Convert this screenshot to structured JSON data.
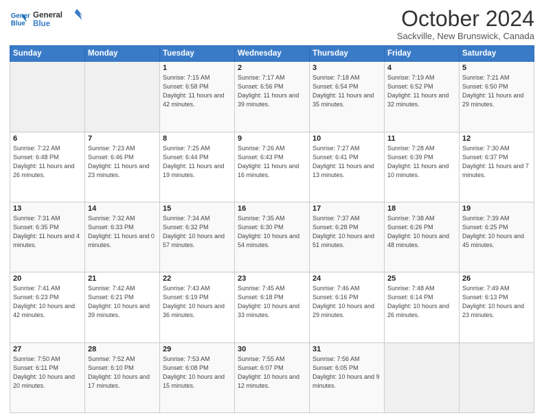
{
  "header": {
    "logo_line1": "General",
    "logo_line2": "Blue",
    "month": "October 2024",
    "location": "Sackville, New Brunswick, Canada"
  },
  "weekdays": [
    "Sunday",
    "Monday",
    "Tuesday",
    "Wednesday",
    "Thursday",
    "Friday",
    "Saturday"
  ],
  "weeks": [
    [
      {
        "num": "",
        "info": ""
      },
      {
        "num": "",
        "info": ""
      },
      {
        "num": "1",
        "info": "Sunrise: 7:15 AM\nSunset: 6:58 PM\nDaylight: 11 hours and 42 minutes."
      },
      {
        "num": "2",
        "info": "Sunrise: 7:17 AM\nSunset: 6:56 PM\nDaylight: 11 hours and 39 minutes."
      },
      {
        "num": "3",
        "info": "Sunrise: 7:18 AM\nSunset: 6:54 PM\nDaylight: 11 hours and 35 minutes."
      },
      {
        "num": "4",
        "info": "Sunrise: 7:19 AM\nSunset: 6:52 PM\nDaylight: 11 hours and 32 minutes."
      },
      {
        "num": "5",
        "info": "Sunrise: 7:21 AM\nSunset: 6:50 PM\nDaylight: 11 hours and 29 minutes."
      }
    ],
    [
      {
        "num": "6",
        "info": "Sunrise: 7:22 AM\nSunset: 6:48 PM\nDaylight: 11 hours and 26 minutes."
      },
      {
        "num": "7",
        "info": "Sunrise: 7:23 AM\nSunset: 6:46 PM\nDaylight: 11 hours and 23 minutes."
      },
      {
        "num": "8",
        "info": "Sunrise: 7:25 AM\nSunset: 6:44 PM\nDaylight: 11 hours and 19 minutes."
      },
      {
        "num": "9",
        "info": "Sunrise: 7:26 AM\nSunset: 6:43 PM\nDaylight: 11 hours and 16 minutes."
      },
      {
        "num": "10",
        "info": "Sunrise: 7:27 AM\nSunset: 6:41 PM\nDaylight: 11 hours and 13 minutes."
      },
      {
        "num": "11",
        "info": "Sunrise: 7:28 AM\nSunset: 6:39 PM\nDaylight: 11 hours and 10 minutes."
      },
      {
        "num": "12",
        "info": "Sunrise: 7:30 AM\nSunset: 6:37 PM\nDaylight: 11 hours and 7 minutes."
      }
    ],
    [
      {
        "num": "13",
        "info": "Sunrise: 7:31 AM\nSunset: 6:35 PM\nDaylight: 11 hours and 4 minutes."
      },
      {
        "num": "14",
        "info": "Sunrise: 7:32 AM\nSunset: 6:33 PM\nDaylight: 11 hours and 0 minutes."
      },
      {
        "num": "15",
        "info": "Sunrise: 7:34 AM\nSunset: 6:32 PM\nDaylight: 10 hours and 57 minutes."
      },
      {
        "num": "16",
        "info": "Sunrise: 7:35 AM\nSunset: 6:30 PM\nDaylight: 10 hours and 54 minutes."
      },
      {
        "num": "17",
        "info": "Sunrise: 7:37 AM\nSunset: 6:28 PM\nDaylight: 10 hours and 51 minutes."
      },
      {
        "num": "18",
        "info": "Sunrise: 7:38 AM\nSunset: 6:26 PM\nDaylight: 10 hours and 48 minutes."
      },
      {
        "num": "19",
        "info": "Sunrise: 7:39 AM\nSunset: 6:25 PM\nDaylight: 10 hours and 45 minutes."
      }
    ],
    [
      {
        "num": "20",
        "info": "Sunrise: 7:41 AM\nSunset: 6:23 PM\nDaylight: 10 hours and 42 minutes."
      },
      {
        "num": "21",
        "info": "Sunrise: 7:42 AM\nSunset: 6:21 PM\nDaylight: 10 hours and 39 minutes."
      },
      {
        "num": "22",
        "info": "Sunrise: 7:43 AM\nSunset: 6:19 PM\nDaylight: 10 hours and 36 minutes."
      },
      {
        "num": "23",
        "info": "Sunrise: 7:45 AM\nSunset: 6:18 PM\nDaylight: 10 hours and 33 minutes."
      },
      {
        "num": "24",
        "info": "Sunrise: 7:46 AM\nSunset: 6:16 PM\nDaylight: 10 hours and 29 minutes."
      },
      {
        "num": "25",
        "info": "Sunrise: 7:48 AM\nSunset: 6:14 PM\nDaylight: 10 hours and 26 minutes."
      },
      {
        "num": "26",
        "info": "Sunrise: 7:49 AM\nSunset: 6:13 PM\nDaylight: 10 hours and 23 minutes."
      }
    ],
    [
      {
        "num": "27",
        "info": "Sunrise: 7:50 AM\nSunset: 6:11 PM\nDaylight: 10 hours and 20 minutes."
      },
      {
        "num": "28",
        "info": "Sunrise: 7:52 AM\nSunset: 6:10 PM\nDaylight: 10 hours and 17 minutes."
      },
      {
        "num": "29",
        "info": "Sunrise: 7:53 AM\nSunset: 6:08 PM\nDaylight: 10 hours and 15 minutes."
      },
      {
        "num": "30",
        "info": "Sunrise: 7:55 AM\nSunset: 6:07 PM\nDaylight: 10 hours and 12 minutes."
      },
      {
        "num": "31",
        "info": "Sunrise: 7:56 AM\nSunset: 6:05 PM\nDaylight: 10 hours and 9 minutes."
      },
      {
        "num": "",
        "info": ""
      },
      {
        "num": "",
        "info": ""
      }
    ]
  ]
}
